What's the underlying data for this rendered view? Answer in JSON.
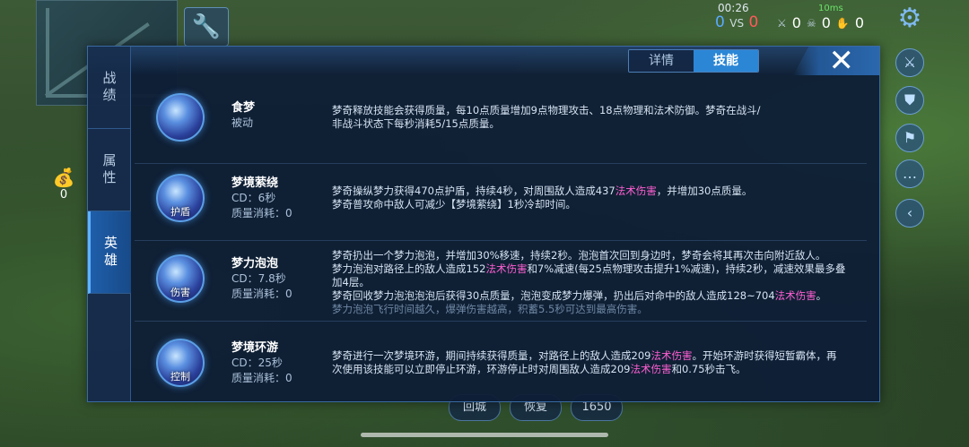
{
  "hud": {
    "timer": "00:26",
    "score_left": "0",
    "vs": "VS",
    "score_right": "0",
    "kills": "0",
    "deaths": "0",
    "assists": "0",
    "network": "10ms",
    "gold": "0",
    "bottom_buttons": [
      "回城",
      "恢复",
      "1650"
    ]
  },
  "panel": {
    "side_tabs": [
      "战绩",
      "属性",
      "英雄"
    ],
    "active_side_tab": "英雄",
    "top_tabs": [
      "详情",
      "技能"
    ],
    "active_top_tab": "技能",
    "close_label": "✕"
  },
  "skills": [
    {
      "name": "食梦",
      "line1": "被动",
      "line2": "",
      "icon_tag": "",
      "desc": [
        [
          {
            "t": "梦奇释放技能会获得质量，每10点质量增加9点物理攻击、18点物理和法术防御。梦奇在战斗/"
          }
        ],
        [
          {
            "t": "非战斗状态下每秒消耗5/15点质量。"
          }
        ]
      ]
    },
    {
      "name": "梦境萦绕",
      "line1": "CD：6秒",
      "line2": "质量消耗：0",
      "icon_tag": "护盾",
      "desc": [
        [
          {
            "t": "梦奇操纵梦力获得470点护盾，持续4秒，对周围敌人造成437"
          },
          {
            "t": "法术伤害",
            "c": "magic"
          },
          {
            "t": "，并增加30点质量。"
          }
        ],
        [
          {
            "t": "梦奇普攻命中敌人可减少【梦境萦绕】1秒冷却时间。"
          }
        ]
      ]
    },
    {
      "name": "梦力泡泡",
      "line1": "CD：7.8秒",
      "line2": "质量消耗：0",
      "icon_tag": "伤害",
      "desc": [
        [
          {
            "t": "梦奇扔出一个梦力泡泡，并增加30%移速，持续2秒。泡泡首次回到身边时，梦奇会将其再次击向附近敌人。"
          }
        ],
        [
          {
            "t": "梦力泡泡对路径上的敌人造成152"
          },
          {
            "t": "法术伤害",
            "c": "magic"
          },
          {
            "t": "和7%减速(每25点物理攻击提升1%减速)，持续2秒，减速效果最多叠"
          }
        ],
        [
          {
            "t": "加4层。"
          }
        ],
        [
          {
            "t": "梦奇回收梦力泡泡泡泡后获得30点质量，泡泡变成梦力爆弹，扔出后对命中的敌人造成128~704"
          },
          {
            "t": "法术伤害",
            "c": "magic"
          },
          {
            "t": "。"
          }
        ],
        [
          {
            "t": "梦力泡泡飞行时间越久，爆弹伤害越高，积蓄5.5秒可达到最高伤害。",
            "c": "dim"
          }
        ]
      ]
    },
    {
      "name": "梦境环游",
      "line1": "CD：25秒",
      "line2": "质量消耗：0",
      "icon_tag": "控制",
      "desc": [
        [
          {
            "t": "梦奇进行一次梦境环游，期间持续获得质量，对路径上的敌人造成209"
          },
          {
            "t": "法术伤害",
            "c": "magic"
          },
          {
            "t": "。开始环游时获得短暂霸体，再"
          }
        ],
        [
          {
            "t": "次使用该技能可以立即停止环游，环游停止时对周围敌人造成209"
          },
          {
            "t": "法术伤害",
            "c": "magic"
          },
          {
            "t": "和0.75秒击飞。"
          }
        ]
      ]
    }
  ]
}
